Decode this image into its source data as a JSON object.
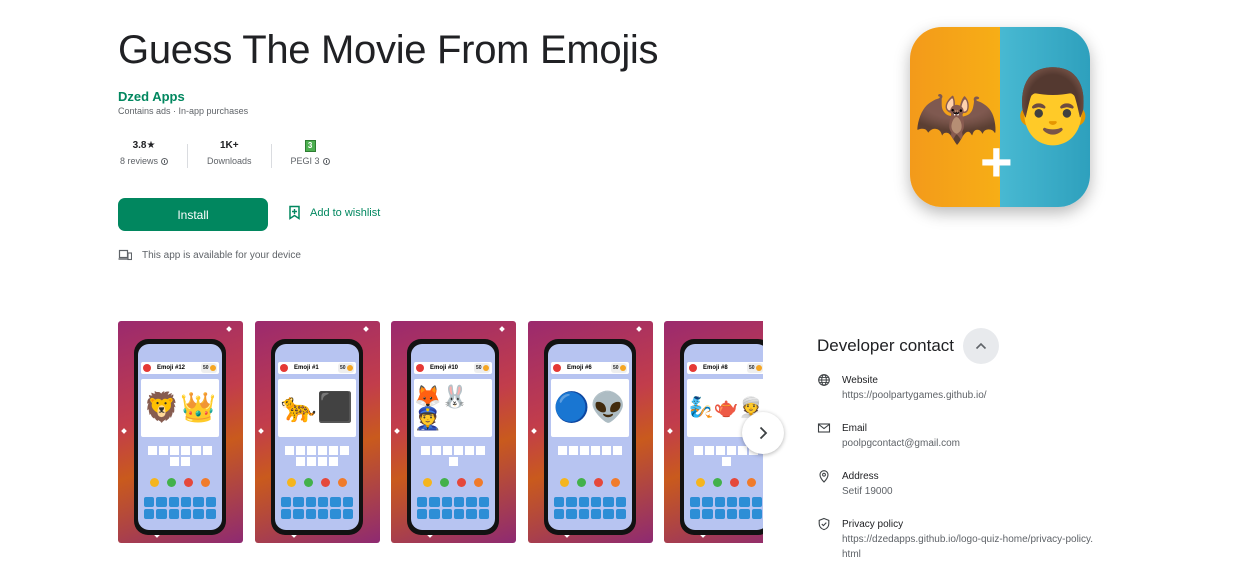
{
  "app": {
    "title": "Guess The Movie From Emojis",
    "developer": "Dzed Apps",
    "subtitle": "Contains ads · In-app purchases"
  },
  "stats": [
    {
      "value": "3.8★",
      "label": "8 reviews"
    },
    {
      "value": "1K+",
      "label": "Downloads"
    },
    {
      "value": "3",
      "label": "PEGI 3"
    }
  ],
  "actions": {
    "install_label": "Install",
    "wishlist_label": "Add to wishlist"
  },
  "availability": "This app is available for your device",
  "icon": {
    "left_emoji": "🦇",
    "right_emoji": "👨",
    "plus": "+"
  },
  "screenshots": [
    {
      "label": "Emoji #12",
      "coins": "50",
      "emojis": "🦁👑"
    },
    {
      "label": "Emoji #1",
      "coins": "50",
      "emojis": "🐆⬛"
    },
    {
      "label": "Emoji #10",
      "coins": "50",
      "emojis": "🦊🐰👮"
    },
    {
      "label": "Emoji #6",
      "coins": "50",
      "emojis": "🔵👽"
    },
    {
      "label": "Emoji #8",
      "coins": "50",
      "emojis": "🧞🫖👳"
    }
  ],
  "developer_contact": {
    "heading": "Developer contact",
    "items": [
      {
        "icon": "globe-icon",
        "label": "Website",
        "value": "https://poolpartygames.github.io/"
      },
      {
        "icon": "email-icon",
        "label": "Email",
        "value": "poolpgcontact@gmail.com"
      },
      {
        "icon": "location-pin-icon",
        "label": "Address",
        "value": "Setif 19000"
      },
      {
        "icon": "shield-icon",
        "label": "Privacy policy",
        "value": "https://dzedapps.github.io/logo-quiz-home/privacy-policy.html"
      }
    ]
  },
  "colors": {
    "accent": "#01875f",
    "text_primary": "#202124",
    "text_secondary": "#5f6368"
  }
}
